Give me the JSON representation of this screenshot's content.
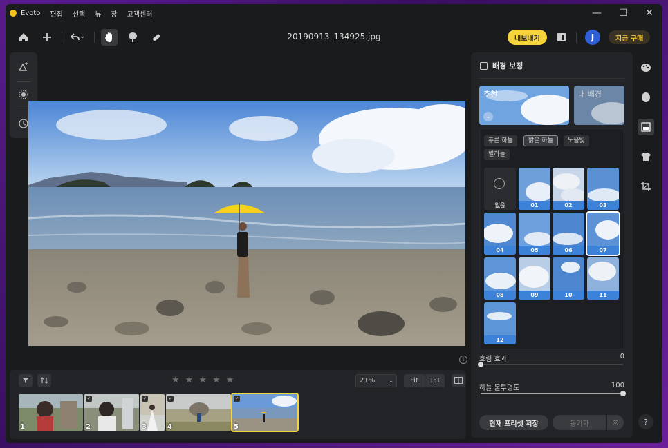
{
  "app": {
    "name": "Evoto"
  },
  "menu": [
    "편집",
    "선택",
    "뷰",
    "창",
    "고객센터"
  ],
  "window_controls": {
    "minimize": "—",
    "maximize": "☐",
    "close": "✕"
  },
  "toolbar": {
    "file_name": "20190913_134925.jpg",
    "export_label": "내보내기",
    "avatar_initial": "J",
    "buy_label": "지금 구매"
  },
  "filmstrip": {
    "zoom_value": "21%",
    "fit_label": "Fit",
    "one_to_one_label": "1:1",
    "rating": 0,
    "thumbnails": [
      {
        "num": "1"
      },
      {
        "num": "2"
      },
      {
        "num": "3"
      },
      {
        "num": "4"
      },
      {
        "num": "5",
        "selected": true
      }
    ]
  },
  "right_panel": {
    "title": "배경 보정",
    "tab_recommended": "추천",
    "tab_my_background": "내 배경",
    "chips": [
      "푸른 하늘",
      "밝은 하늘",
      "노을빛",
      "별하늘"
    ],
    "active_chip": "밝은 하늘",
    "none_label": "없음",
    "presets": [
      "01",
      "02",
      "03",
      "04",
      "05",
      "06",
      "07",
      "08",
      "09",
      "10",
      "11",
      "12"
    ],
    "selected_preset": "07",
    "blur_label": "흐림 효과",
    "blur_value": "0",
    "sky_opacity_label": "하늘 불투명도",
    "sky_opacity_value": "100",
    "save_preset_label": "현재 프리셋 저장",
    "sync_label": "동기화"
  },
  "help_label": "?",
  "colors": {
    "accent_yellow": "#f5d33a",
    "preset_label_blue": "#3b82d8",
    "avatar_blue": "#2f5fd8"
  }
}
